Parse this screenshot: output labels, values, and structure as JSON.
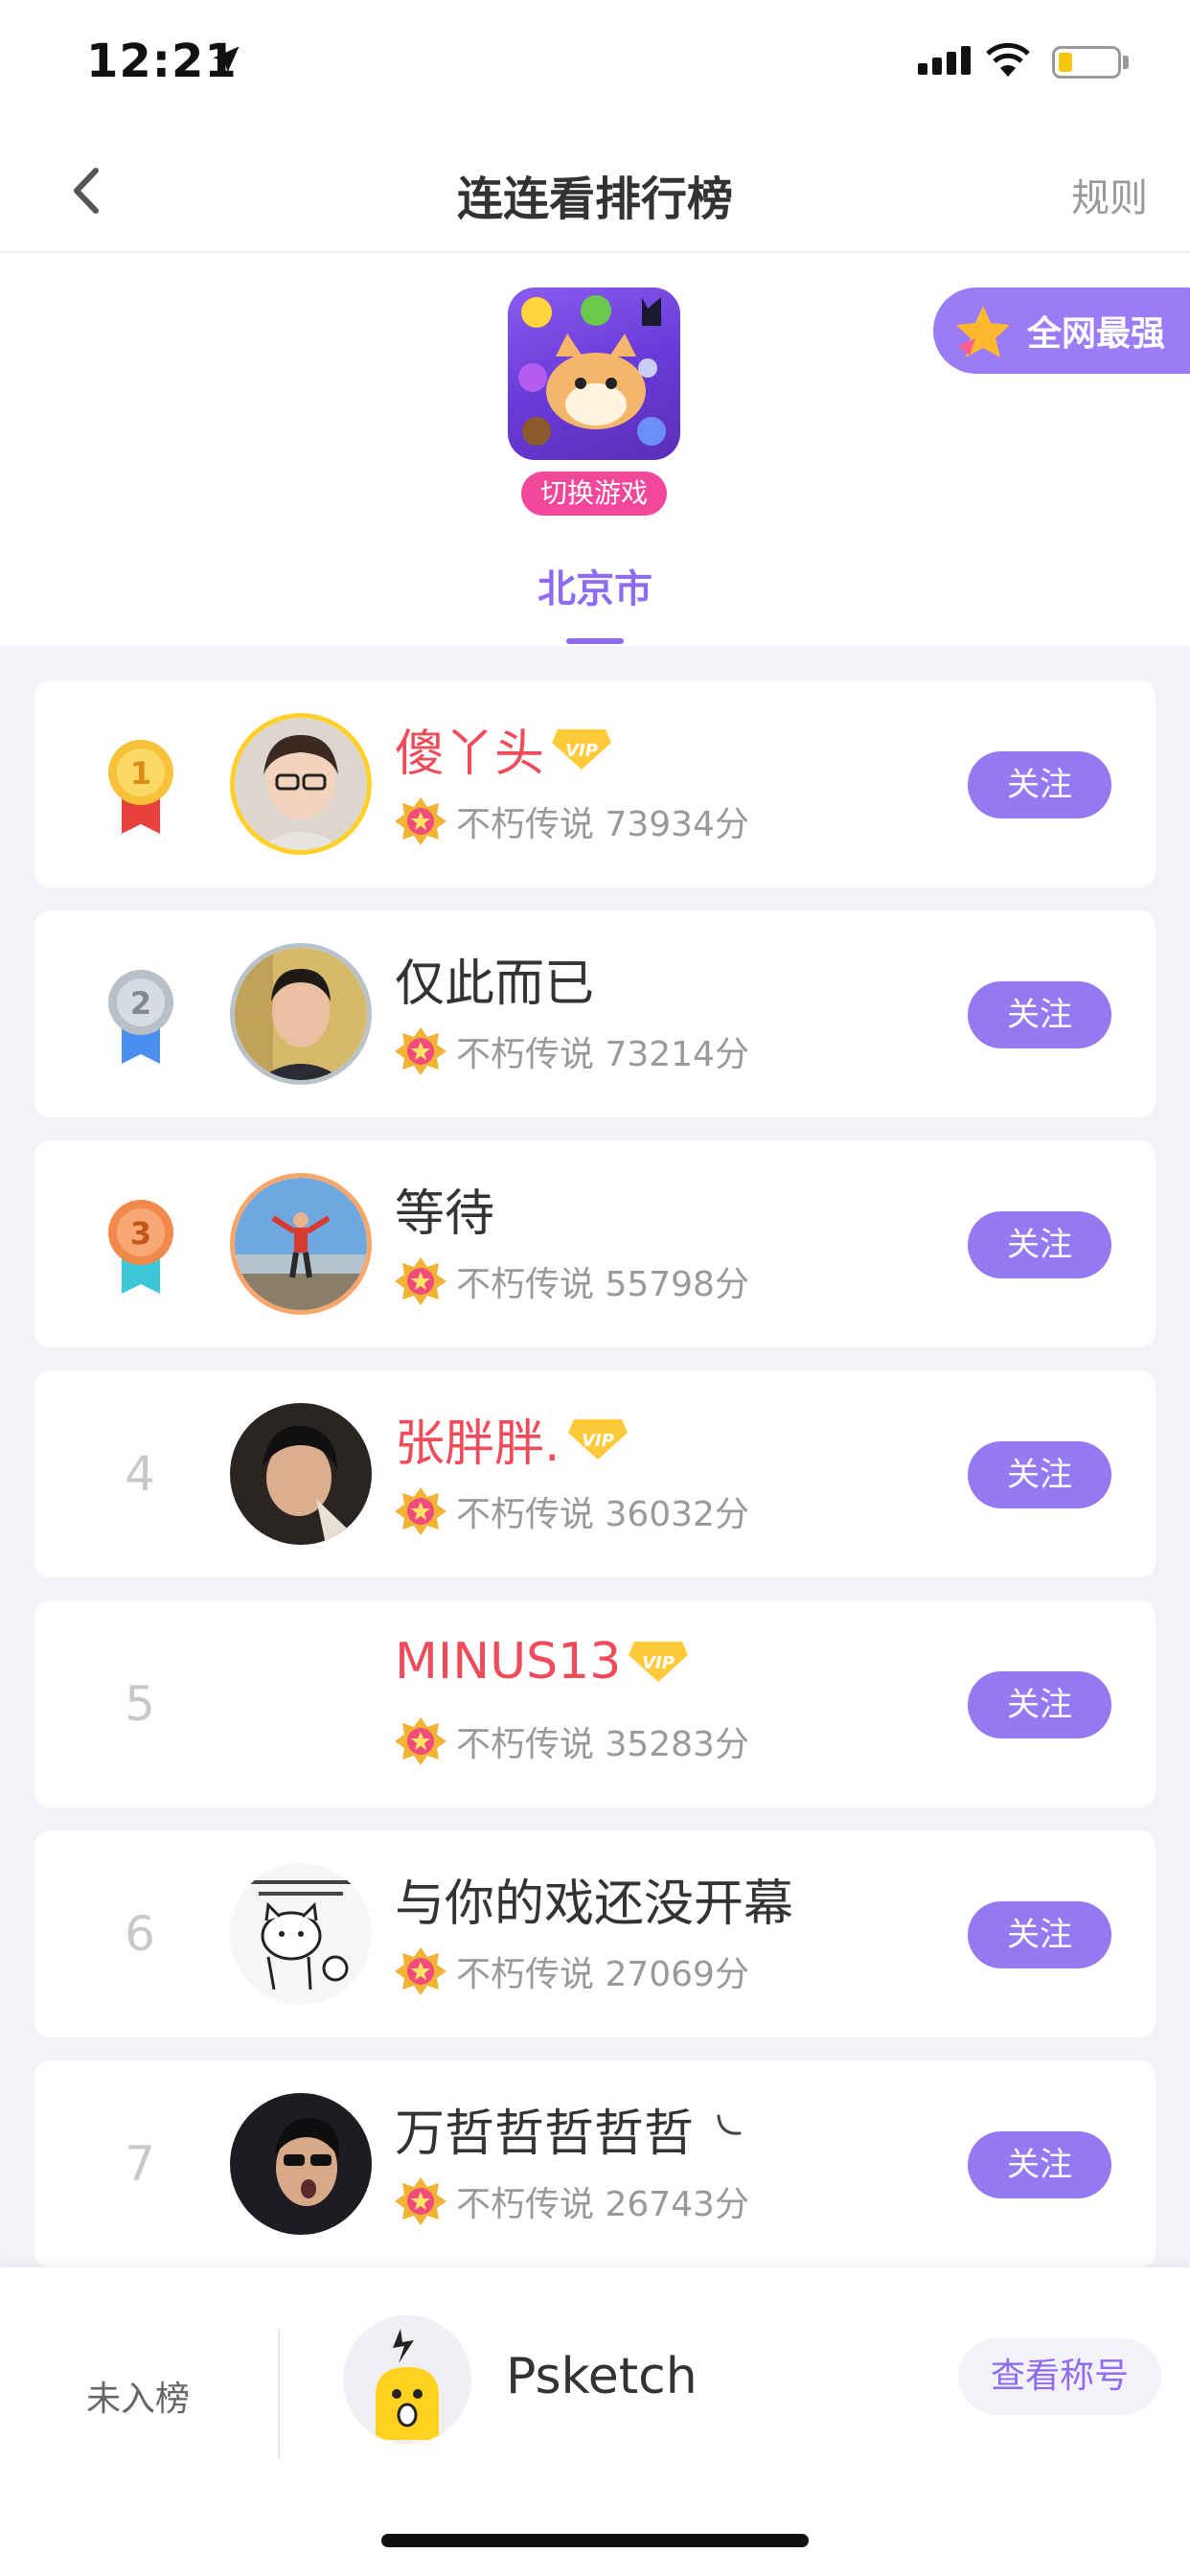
{
  "status_bar": {
    "time": "12:21"
  },
  "nav": {
    "title": "连连看排行榜",
    "rules": "规则"
  },
  "header": {
    "switch_game": "切换游戏",
    "best_badge": "全网最强",
    "city_tab": "北京市"
  },
  "ranking": [
    {
      "rank": "1",
      "name": "傻丫头",
      "vip": true,
      "score": "不朽传说 73934分",
      "follow": "关注",
      "medal": "gold"
    },
    {
      "rank": "2",
      "name": "仅此而已",
      "vip": false,
      "score": "不朽传说 73214分",
      "follow": "关注",
      "medal": "silver"
    },
    {
      "rank": "3",
      "name": "等待",
      "vip": false,
      "score": "不朽传说 55798分",
      "follow": "关注",
      "medal": "bronze"
    },
    {
      "rank": "4",
      "name": "张胖胖.",
      "vip": true,
      "score": "不朽传说 36032分",
      "follow": "关注"
    },
    {
      "rank": "5",
      "name": "MINUS13",
      "vip": true,
      "score": "不朽传说 35283分",
      "follow": "关注"
    },
    {
      "rank": "6",
      "name": "与你的戏还没开幕",
      "vip": false,
      "score": "不朽传说 27069分",
      "follow": "关注"
    },
    {
      "rank": "7",
      "name": "万哲哲哲哲哲",
      "vip": false,
      "score": "不朽传说 26743分",
      "follow": "关注"
    }
  ],
  "bottom": {
    "status": "未入榜",
    "username": "Psketch",
    "titles_button": "查看称号"
  },
  "colors": {
    "accent": "#9579f1",
    "vip_name": "#f04b5b",
    "switch_game": "#f2489b"
  }
}
